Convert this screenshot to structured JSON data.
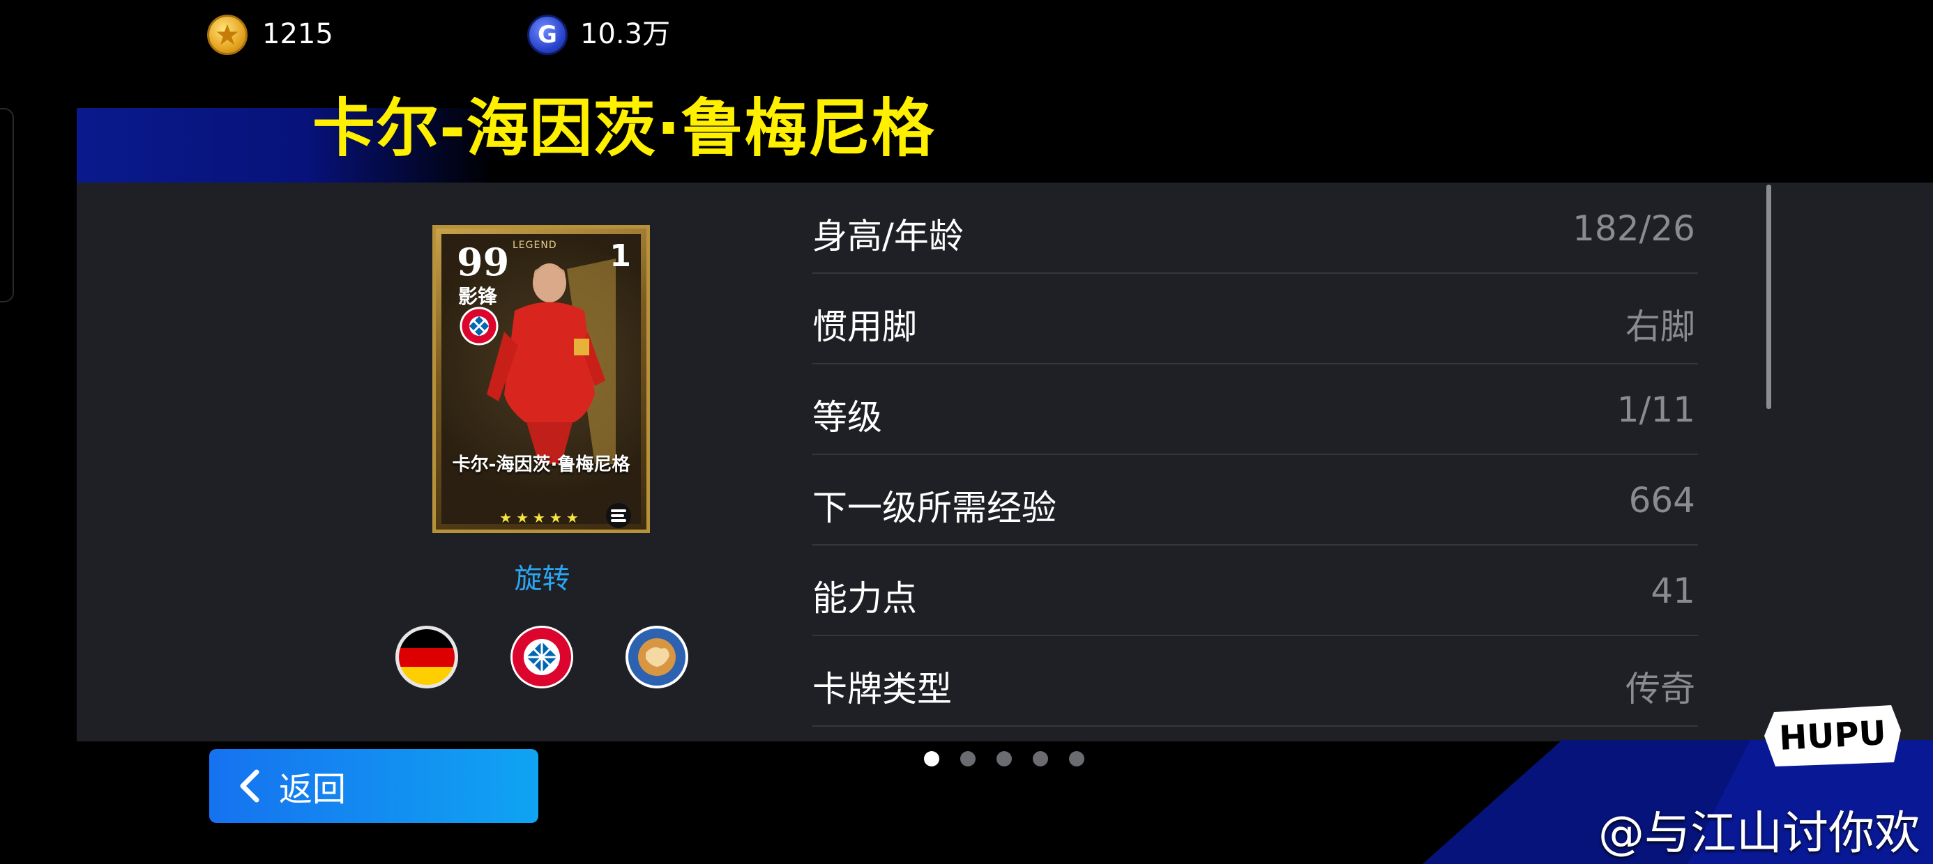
{
  "currencies": {
    "gold": {
      "icon": "gold-coin-star-icon",
      "amount": "1215"
    },
    "gp": {
      "icon": "gp-coin-icon",
      "symbol": "G",
      "amount": "10.3万"
    }
  },
  "player": {
    "title": "卡尔-海因茨·鲁梅尼格"
  },
  "card": {
    "rating": "99",
    "position": "影锋",
    "legend_label": "LEGEND",
    "level": "1",
    "name": "卡尔-海因茨·鲁梅尼格",
    "stars": "★★★★★",
    "rotate_label": "旋转"
  },
  "badges": [
    {
      "name": "germany-flag-icon"
    },
    {
      "name": "bayern-munich-crest-icon"
    },
    {
      "name": "europa-league-badge-icon"
    }
  ],
  "stats": [
    {
      "label": "身高/年龄",
      "value": "182/26"
    },
    {
      "label": "惯用脚",
      "value": "右脚"
    },
    {
      "label": "等级",
      "value": "1/11"
    },
    {
      "label": "下一级所需经验",
      "value": "664"
    },
    {
      "label": "能力点",
      "value": "41"
    },
    {
      "label": "卡牌类型",
      "value": "传奇"
    }
  ],
  "pagination": {
    "total": 5,
    "current": 1
  },
  "back_button": {
    "label": "返回"
  },
  "hupu_logo": {
    "text": "HUPU"
  },
  "watermark": {
    "text": "@与江山讨你欢"
  },
  "colors": {
    "title_yellow": "#fff000",
    "panel_bg": "#1f2025",
    "link_blue": "#2aa6f2",
    "button_blue_start": "#1672f0",
    "button_blue_end": "#10a4f2",
    "value_gray": "#8a8b90"
  }
}
